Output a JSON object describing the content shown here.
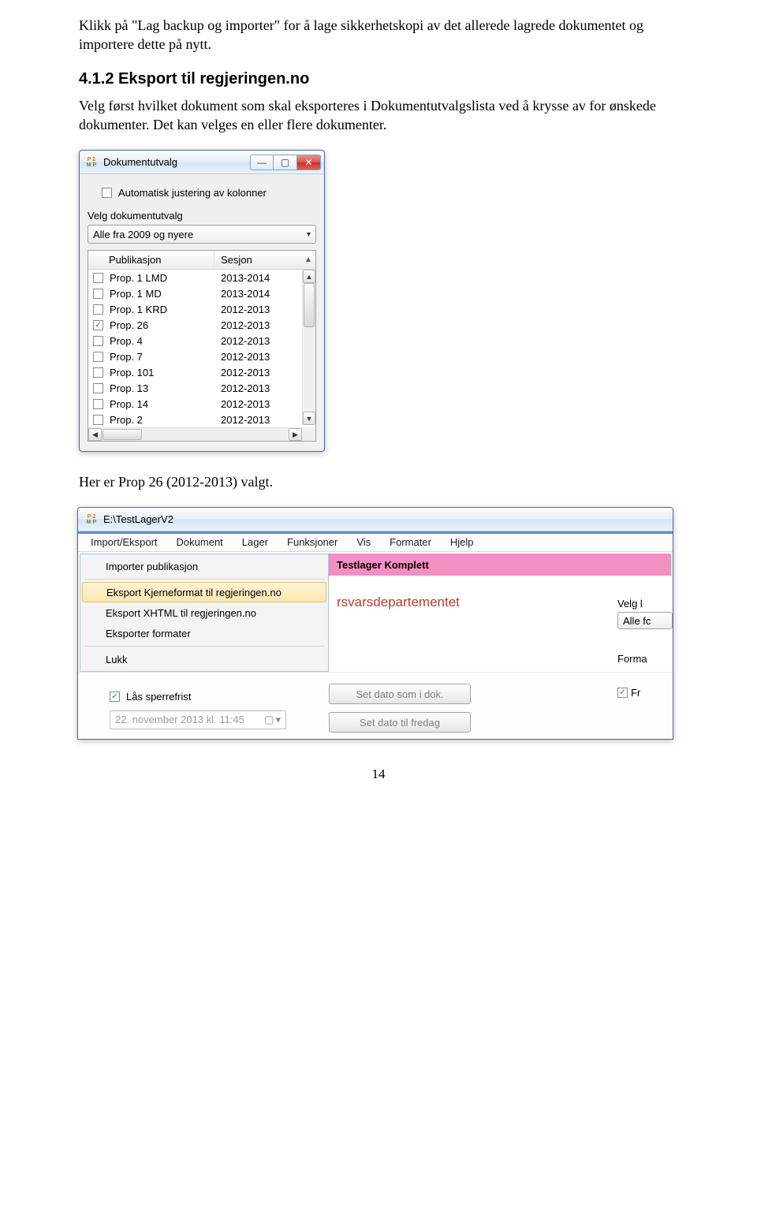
{
  "intro": {
    "p1": "Klikk på \"Lag backup og importer\" for å lage sikkerhetskopi av det allerede lagrede dokumentet og importere dette på nytt."
  },
  "heading": "4.1.2  Eksport til regjeringen.no",
  "para2": "Velg først hvilket dokument som skal eksporteres i Dokumentutvalgslista ved å krysse av for ønskede dokumenter. Det kan velges en eller flere dokumenter.",
  "dlg": {
    "title": "Dokumentutvalg",
    "autojust": "Automatisk justering av kolonner",
    "velg": "Velg dokumentutvalg",
    "combo": "Alle fra 2009 og nyere",
    "colP": "Publikasjon",
    "colS": "Sesjon",
    "rows": [
      {
        "cb": false,
        "p": "Prop. 1  LMD",
        "s": "2013-2014"
      },
      {
        "cb": false,
        "p": "Prop. 1  MD",
        "s": "2013-2014"
      },
      {
        "cb": false,
        "p": "Prop. 1  KRD",
        "s": "2012-2013"
      },
      {
        "cb": true,
        "p": "Prop. 26",
        "s": "2012-2013"
      },
      {
        "cb": false,
        "p": "Prop. 4",
        "s": "2012-2013"
      },
      {
        "cb": false,
        "p": "Prop. 7",
        "s": "2012-2013"
      },
      {
        "cb": false,
        "p": "Prop. 101",
        "s": "2012-2013"
      },
      {
        "cb": false,
        "p": "Prop. 13",
        "s": "2012-2013"
      },
      {
        "cb": false,
        "p": "Prop. 14",
        "s": "2012-2013"
      },
      {
        "cb": false,
        "p": "Prop. 2",
        "s": "2012-2013"
      }
    ]
  },
  "midtext": "Her er Prop 26 (2012-2013) valgt.",
  "app": {
    "path": "E:\\TestLagerV2",
    "menus": [
      "Import/Eksport",
      "Dokument",
      "Lager",
      "Funksjoner",
      "Vis",
      "Formater",
      "Hjelp"
    ],
    "dd": {
      "i1": "Importer publikasjon",
      "i2": "Eksport Kjerneformat til regjeringen.no",
      "i3": "Eksport XHTML til regjeringen.no",
      "i4": "Eksporter formater",
      "i5": "Lukk"
    },
    "banner": "Testlager Komplett",
    "dept": "rsvarsdepartementet",
    "side": {
      "velg": "Velg l",
      "alle": "Alle fc",
      "forma": "Forma",
      "fr": "Fr"
    },
    "lock": "Lås sperrefrist",
    "date": "22. november 2013  kl. 11:45",
    "btn1": "Set dato som i dok.",
    "btn2": "Set dato til fredag"
  },
  "page": "14"
}
